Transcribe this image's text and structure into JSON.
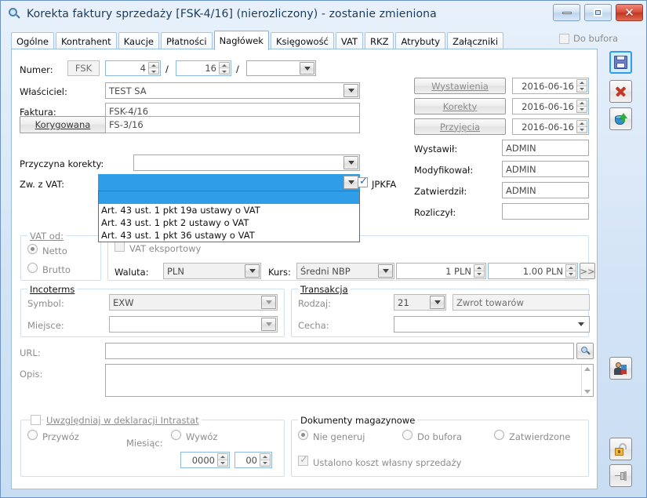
{
  "window": {
    "title": "Korekta faktury sprzedaży [FSK-4/16] (nierozliczony) - zostanie zmieniona",
    "icon": "magnifier-icon",
    "minimize_label": "–",
    "maximize_label": "□",
    "close_label": "✕"
  },
  "tabs": [
    {
      "label": "Ogólne",
      "active": false
    },
    {
      "label": "Kontrahent",
      "active": false
    },
    {
      "label": "Kaucje",
      "active": false
    },
    {
      "label": "Płatności",
      "active": false
    },
    {
      "label": "Nagłówek",
      "active": true
    },
    {
      "label": "Księgowość",
      "active": false
    },
    {
      "label": "VAT",
      "active": false
    },
    {
      "label": "RKZ",
      "active": false
    },
    {
      "label": "Atrybuty",
      "active": false
    },
    {
      "label": "Załączniki",
      "active": false
    }
  ],
  "tabs_right": {
    "do_bufora_label": "Do bufora",
    "do_bufora_checked": false,
    "enabled": false
  },
  "form": {
    "numer_label": "Numer:",
    "numer_prefix": "FSK",
    "numer_seq": "4",
    "numer_year": "16",
    "numer_series": "",
    "separator": "/",
    "wlasciciel_label": "Właściciel:",
    "wlasciciel_value": "TEST SA",
    "faktura_label": "Faktura:",
    "faktura_value": "FSK-4/16",
    "korygowana_button": "Korygowana",
    "korygowana_value": "FS-3/16",
    "przyczyna_label": "Przyczyna korekty:",
    "przyczyna_value": "",
    "zw_vat_label": "Zw. z VAT:",
    "zw_vat_value": "",
    "jpkfa_label": "JPKFA",
    "jpkfa_checked": true
  },
  "zw_vat_dropdown": {
    "open": true,
    "items": [
      {
        "text": "",
        "selected": true
      },
      {
        "text": "Art. 43 ust. 1 pkt 19a ustawy o VAT",
        "selected": false
      },
      {
        "text": "Art. 43 ust. 1 pkt 2 ustawy o VAT",
        "selected": false
      },
      {
        "text": "Art. 43 ust. 1 pkt 36 ustawy o VAT",
        "selected": false
      }
    ]
  },
  "dates": {
    "wystawienia_label": "Wystawienia",
    "wystawienia_value": "2016-06-16",
    "korekty_label": "Korekty",
    "korekty_value": "2016-06-16",
    "przyjecia_label": "Przyjęcia",
    "przyjecia_value": "2016-06-16"
  },
  "users": {
    "wystawil_label": "Wystawił:",
    "wystawil_value": "ADMIN",
    "modyfikowal_label": "Modyfikował:",
    "modyfikowal_value": "ADMIN",
    "zatwierdzil_label": "Zatwierdził:",
    "zatwierdzil_value": "ADMIN",
    "rozliczyl_label": "Rozliczył:",
    "rozliczyl_value": ""
  },
  "vat_od": {
    "title": "VAT od:",
    "netto_label": "Netto",
    "brutto_label": "Brutto",
    "selected": "Netto"
  },
  "currency": {
    "vat_eksportowy_label": "VAT eksportowy",
    "vat_eksportowy_checked": false,
    "waluta_label": "Waluta:",
    "waluta_value": "PLN",
    "kurs_label": "Kurs:",
    "kurs_type": "Średni NBP",
    "kurs_from": "1 PLN",
    "kurs_to": "1.00 PLN",
    "more_button": ">>"
  },
  "incoterms": {
    "title": "Incoterms",
    "symbol_label": "Symbol:",
    "symbol_value": "EXW",
    "miejsce_label": "Miejsce:",
    "miejsce_value": ""
  },
  "transakcja": {
    "title": "Transakcja",
    "rodzaj_label": "Rodzaj:",
    "rodzaj_code": "21",
    "rodzaj_value": "Zwrot towarów",
    "cecha_label": "Cecha:",
    "cecha_value": ""
  },
  "url": {
    "label": "URL:",
    "value": "",
    "browse_icon": "magnifier-icon"
  },
  "opis": {
    "label": "Opis:",
    "value": ""
  },
  "intrastat": {
    "title": "Uwzględniaj w deklaracji Intrastat",
    "checked": false,
    "przywoz_label": "Przywóz",
    "wywoz_label": "Wywóz",
    "miesiac_label": "Miesiąc:",
    "rok_value": "0000",
    "miesiac_value": "00"
  },
  "dokumenty": {
    "title": "Dokumenty magazynowe",
    "options": [
      {
        "label": "Nie generuj",
        "selected": true
      },
      {
        "label": "Do bufora",
        "selected": false
      },
      {
        "label": "Zatwierdzone",
        "selected": false
      }
    ],
    "koszt_label": "Ustalono koszt własny sprzedaży",
    "koszt_checked": true
  },
  "side_toolbar": [
    {
      "name": "save-button",
      "icon": "floppy-disk-icon",
      "highlighted": true
    },
    {
      "name": "cancel-button",
      "icon": "red-x-icon",
      "highlighted": false
    },
    {
      "name": "export-button",
      "icon": "database-export-icon",
      "highlighted": false
    },
    {
      "name": "contact-button",
      "icon": "person-icon",
      "highlighted": false
    },
    {
      "name": "unlock-button",
      "icon": "open-padlock-icon",
      "highlighted": false
    },
    {
      "name": "pin-button",
      "icon": "pin-icon",
      "highlighted": false
    }
  ],
  "colors": {
    "accent": "#2f9de8",
    "window_chrome": "#c9ddf2",
    "title_text": "#16385c",
    "close_button": "#d94c38"
  }
}
